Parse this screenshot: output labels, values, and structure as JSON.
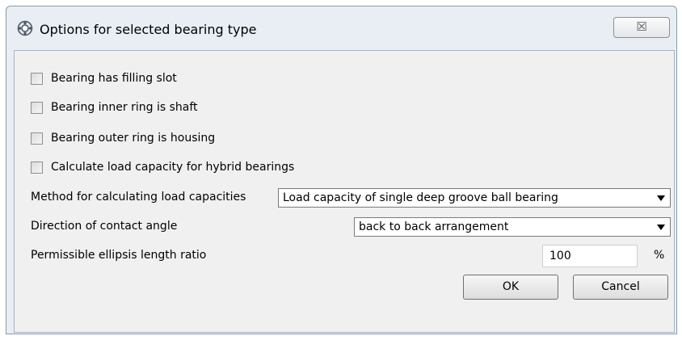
{
  "window": {
    "title": "Options for selected bearing type",
    "close_glyph": "☒",
    "icon": "bearing-app-icon"
  },
  "checkboxes": [
    {
      "label": "Bearing has filling slot",
      "checked": false
    },
    {
      "label": "Bearing inner ring is shaft",
      "checked": false
    },
    {
      "label": "Bearing outer ring is housing",
      "checked": false
    },
    {
      "label": "Calculate load capacity for hybrid bearings",
      "checked": false
    }
  ],
  "method": {
    "label": "Method for calculating load capacities",
    "value": "Load capacity of single deep groove ball bearing"
  },
  "contact_angle": {
    "label": "Direction of contact angle",
    "value": "back to back arrangement"
  },
  "ellipsis": {
    "label": "Permissible ellipsis length ratio",
    "value": "100",
    "unit": "%"
  },
  "buttons": {
    "ok": "OK",
    "cancel": "Cancel"
  }
}
